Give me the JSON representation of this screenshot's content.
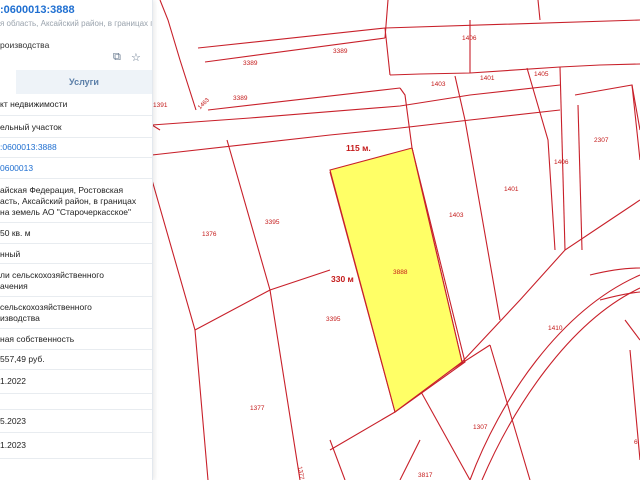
{
  "panel": {
    "title": ":0600013:3888",
    "address_line": "я область, Аксайский район, в границах плана",
    "purpose": "роизводства",
    "icons": [
      "share-icon",
      "star-icon"
    ],
    "tabs": {
      "services": "Услуги"
    },
    "fields": [
      "кт недвижимости",
      "ельный участок",
      ":0600013:3888",
      "0600013",
      "айская Федерация, Ростовская",
      "асть, Аксайский район, в границах",
      "на земель АО \"Старочеркасское\"",
      "50 кв. м",
      "нный",
      "ли сельскохозяйственного",
      "ачения",
      "сельскохозяйственного",
      "изводства",
      "ная собственность",
      "557,49 руб.",
      "1.2022",
      "5.2023",
      "1.2023"
    ]
  },
  "map": {
    "selected_parcel": "3888",
    "dimension_width": "115 м.",
    "dimension_length": "330 м",
    "parcel_labels": [
      "1406",
      "3389",
      "3389",
      "3389",
      "1391",
      "1463",
      "1403",
      "1401",
      "1405",
      "2307",
      "1406",
      "1401",
      "1403",
      "1376",
      "3395",
      "3395",
      "1377",
      "1377",
      "1410",
      "1307",
      "3817",
      "6"
    ],
    "colors": {
      "boundary": "#c8202a",
      "selected_fill": "#ffff66",
      "road": "#c8202a"
    }
  }
}
